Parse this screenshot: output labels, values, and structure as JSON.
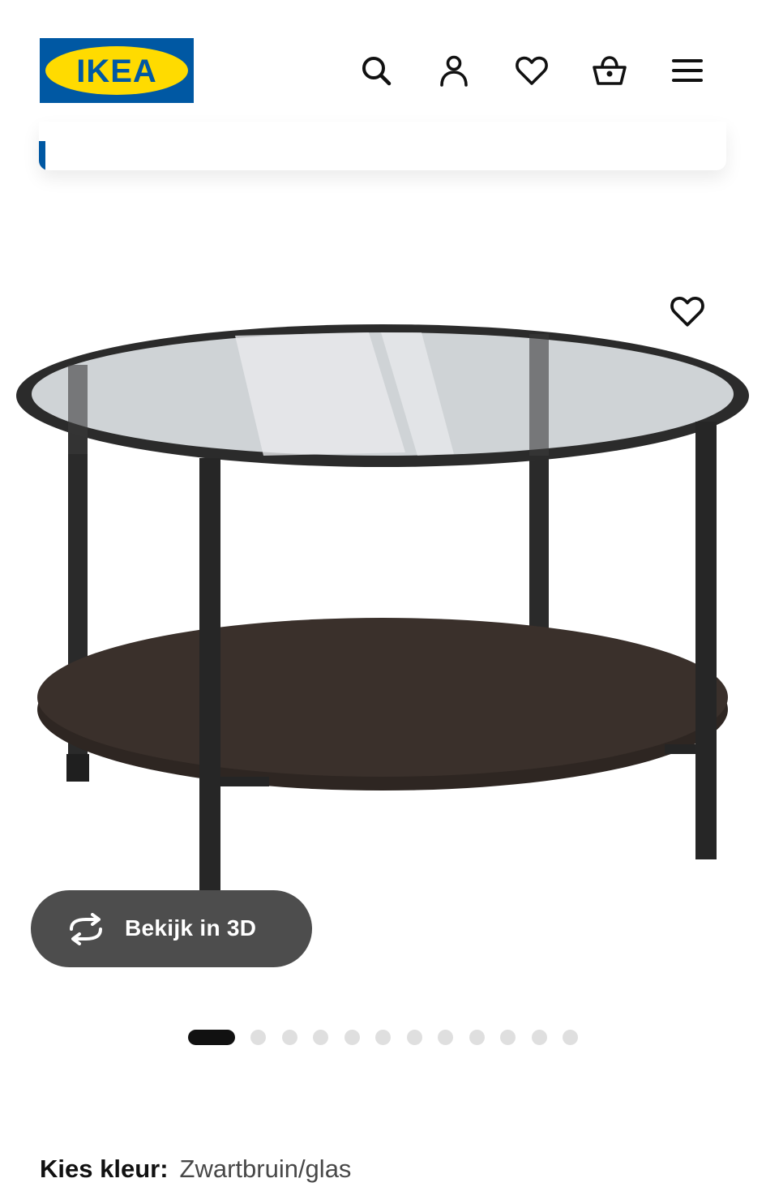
{
  "header": {
    "logo_text": "IKEA",
    "brand_colors": {
      "blue": "#0058a3",
      "yellow": "#ffdb00"
    },
    "icons": [
      "search-icon",
      "account-icon",
      "heart-icon",
      "basket-icon",
      "menu-icon"
    ]
  },
  "notice": {
    "accent_color": "#0058a3"
  },
  "product": {
    "image_subject": "round coffee table with glass top and dark shelf",
    "favorite_icon": "heart-icon",
    "view_3d_label": "Bekijk in 3D",
    "view_3d_icon": "rotate-3d-icon"
  },
  "carousel": {
    "total_slides": 12,
    "active_index": 0
  },
  "color": {
    "label": "Kies kleur:",
    "value": "Zwartbruin/glas"
  }
}
